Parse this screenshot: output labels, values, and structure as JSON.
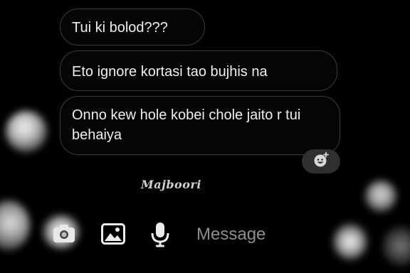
{
  "messages": [
    {
      "text": "Tui ki bolod???"
    },
    {
      "text": "Eto ignore kortasi tao bujhis na"
    },
    {
      "text": "Onno kew hole kobei chole jaito r tui behaiya"
    }
  ],
  "reaction": {
    "icon": "add-emoji-reaction-icon"
  },
  "caption": "Majboori",
  "composer": {
    "placeholder": "Message",
    "icons": [
      "camera-icon",
      "gallery-icon",
      "microphone-icon"
    ]
  },
  "colors": {
    "background": "#000000",
    "bubble_border": "#3a3a3a",
    "text": "#efefef",
    "placeholder": "#8d8d8d"
  }
}
